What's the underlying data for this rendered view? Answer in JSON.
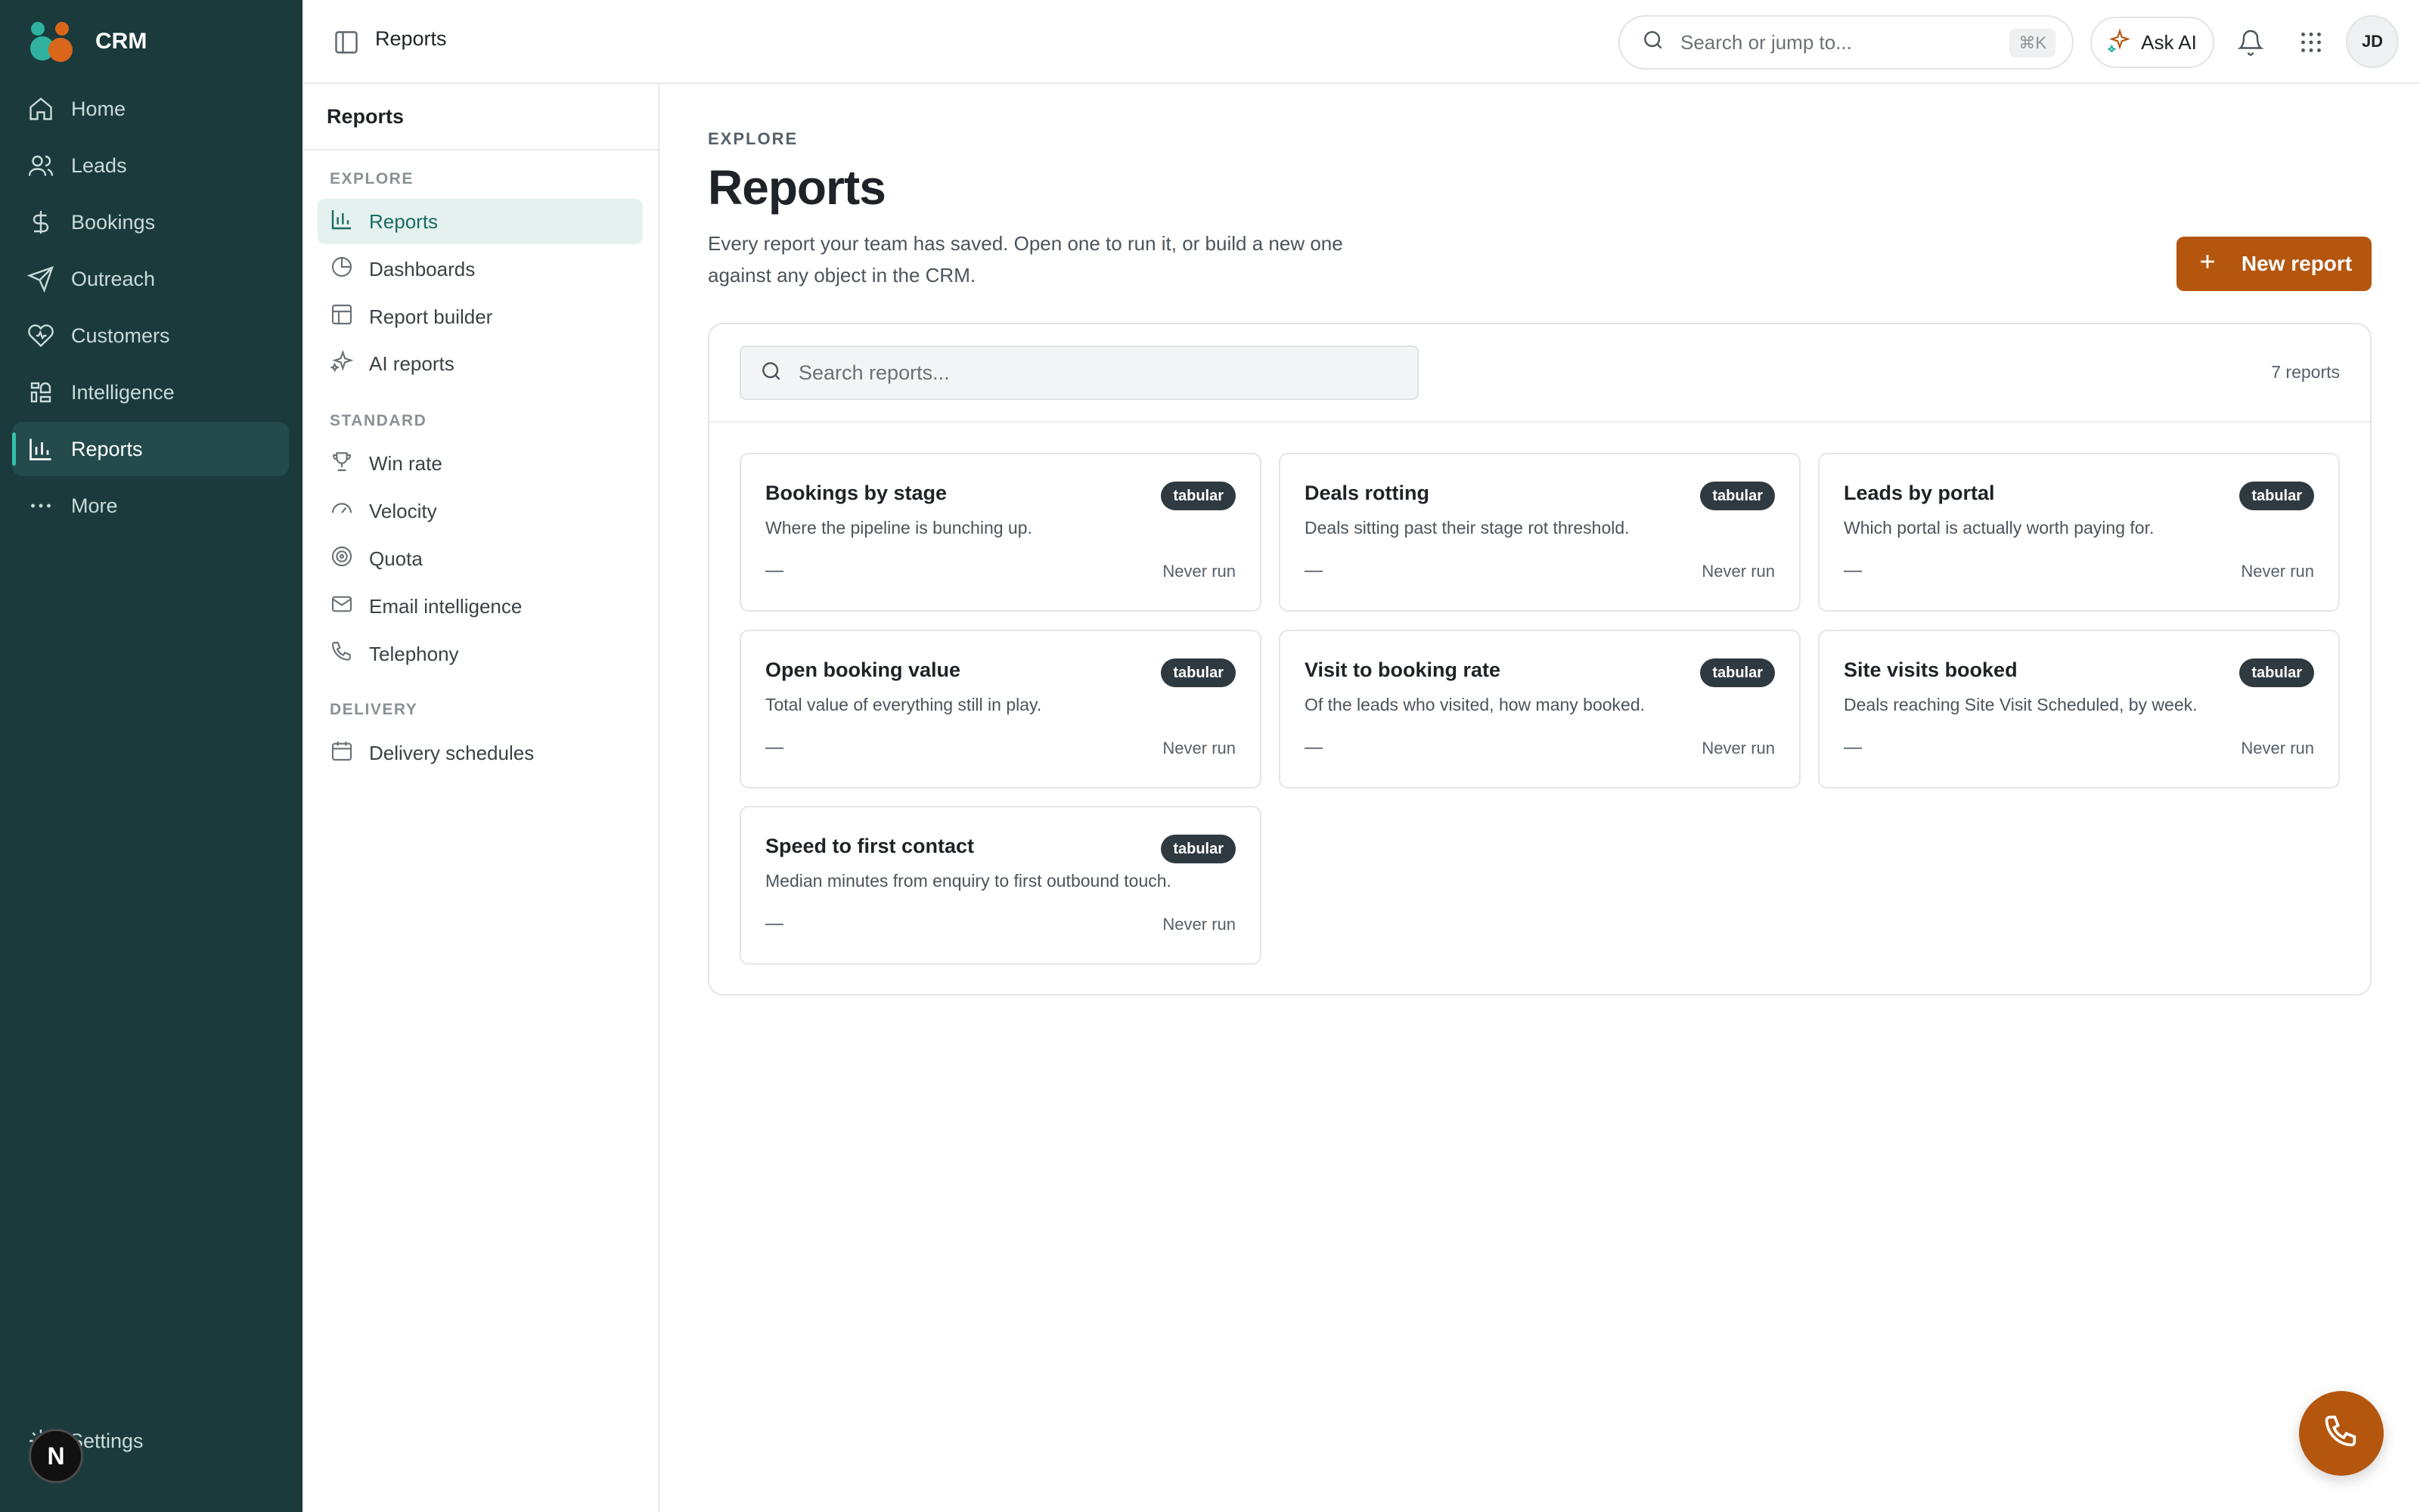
{
  "app": {
    "name": "CRM"
  },
  "sidebar": {
    "items": [
      {
        "label": "Home",
        "icon": "home-icon"
      },
      {
        "label": "Leads",
        "icon": "users-icon"
      },
      {
        "label": "Bookings",
        "icon": "dollar-icon"
      },
      {
        "label": "Outreach",
        "icon": "send-icon"
      },
      {
        "label": "Customers",
        "icon": "heart-icon"
      },
      {
        "label": "Intelligence",
        "icon": "brain-icon"
      },
      {
        "label": "Reports",
        "icon": "bar-chart-icon",
        "active": true
      },
      {
        "label": "More",
        "icon": "more-icon"
      }
    ],
    "settings_label": "Settings",
    "badge_letter": "N"
  },
  "topbar": {
    "breadcrumb": "Reports",
    "search_placeholder": "Search or jump to...",
    "search_shortcut": "⌘K",
    "ask_ai_label": "Ask AI",
    "avatar_initials": "JD"
  },
  "subnav": {
    "title": "Reports",
    "sections": [
      {
        "label": "EXPLORE",
        "items": [
          {
            "label": "Reports",
            "icon": "bar-chart-icon",
            "active": true
          },
          {
            "label": "Dashboards",
            "icon": "pie-chart-icon"
          },
          {
            "label": "Report builder",
            "icon": "layout-icon"
          },
          {
            "label": "AI reports",
            "icon": "sparkles-icon"
          }
        ]
      },
      {
        "label": "STANDARD",
        "items": [
          {
            "label": "Win rate",
            "icon": "trophy-icon"
          },
          {
            "label": "Velocity",
            "icon": "gauge-icon"
          },
          {
            "label": "Quota",
            "icon": "target-icon"
          },
          {
            "label": "Email intelligence",
            "icon": "mail-icon"
          },
          {
            "label": "Telephony",
            "icon": "phone-icon"
          }
        ]
      },
      {
        "label": "DELIVERY",
        "items": [
          {
            "label": "Delivery schedules",
            "icon": "calendar-icon"
          }
        ]
      }
    ]
  },
  "main": {
    "eyebrow": "EXPLORE",
    "title": "Reports",
    "description": "Every report your team has saved. Open one to run it, or build a new one against any object in the CRM.",
    "new_report_label": "New report",
    "search_placeholder": "Search reports...",
    "report_count": "7 reports",
    "reports": [
      {
        "title": "Bookings by stage",
        "tag": "tabular",
        "description": "Where the pipeline is bunching up.",
        "value": "—",
        "status": "Never run"
      },
      {
        "title": "Deals rotting",
        "tag": "tabular",
        "description": "Deals sitting past their stage rot threshold.",
        "value": "—",
        "status": "Never run"
      },
      {
        "title": "Leads by portal",
        "tag": "tabular",
        "description": "Which portal is actually worth paying for.",
        "value": "—",
        "status": "Never run"
      },
      {
        "title": "Open booking value",
        "tag": "tabular",
        "description": "Total value of everything still in play.",
        "value": "—",
        "status": "Never run"
      },
      {
        "title": "Visit to booking rate",
        "tag": "tabular",
        "description": "Of the leads who visited, how many booked.",
        "value": "—",
        "status": "Never run"
      },
      {
        "title": "Site visits booked",
        "tag": "tabular",
        "description": "Deals reaching Site Visit Scheduled, by week.",
        "value": "—",
        "status": "Never run"
      },
      {
        "title": "Speed to first contact",
        "tag": "tabular",
        "description": "Median minutes from enquiry to first outbound touch.",
        "value": "—",
        "status": "Never run"
      }
    ]
  },
  "colors": {
    "sidebar_bg": "#1b3a3c",
    "accent": "#b5560f",
    "active_teal": "#33c1a8"
  }
}
